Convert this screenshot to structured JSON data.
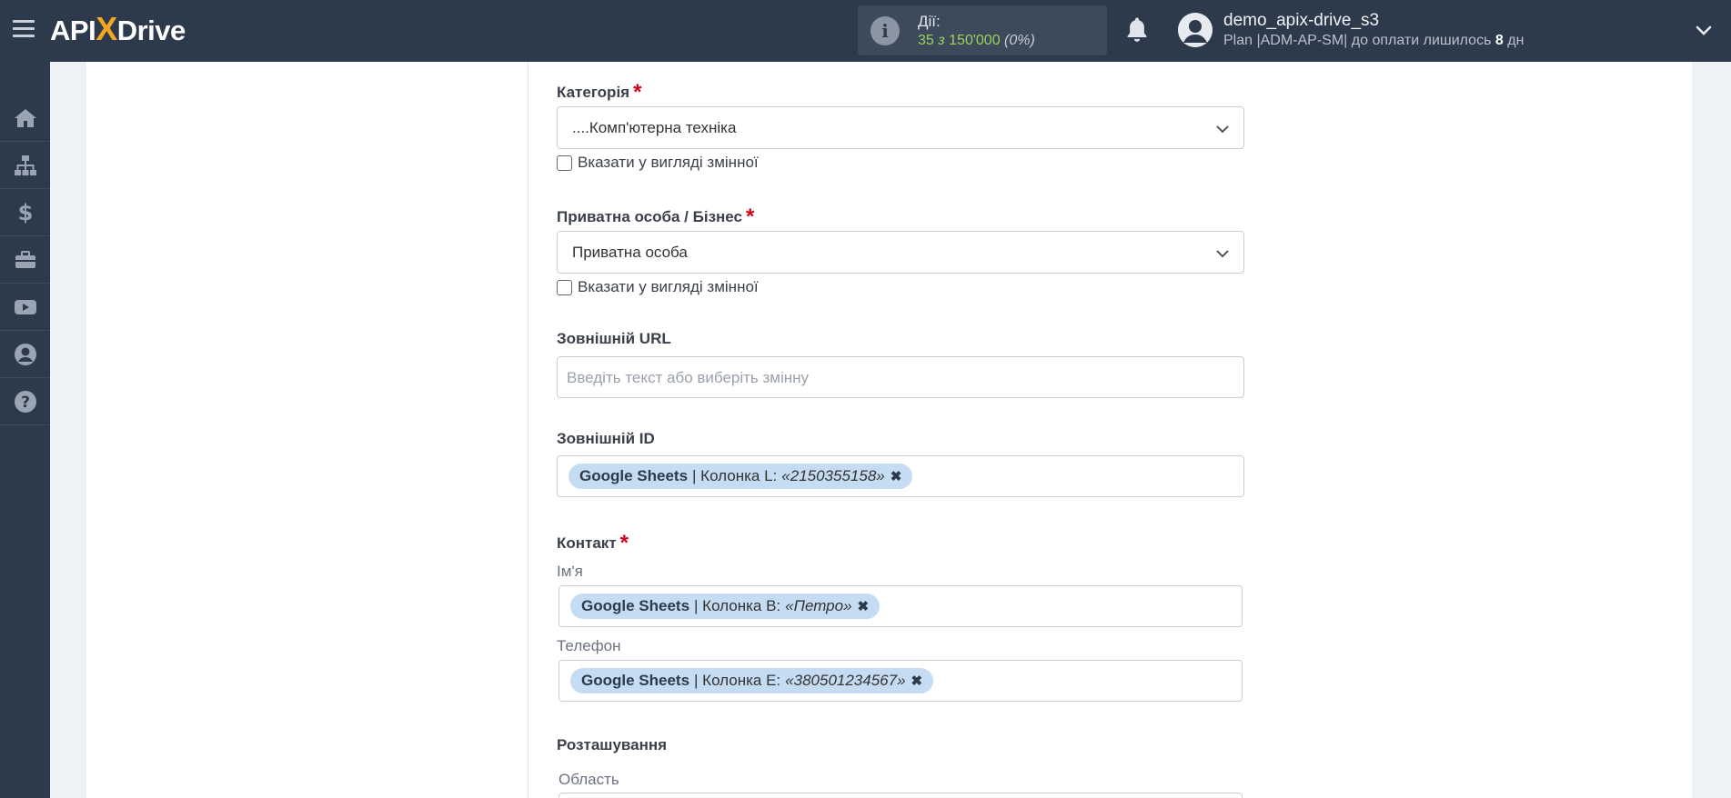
{
  "header": {
    "logo_api": "API",
    "logo_x": "X",
    "logo_drive": "Drive",
    "actions_label": "Дії:",
    "actions_used": "35",
    "actions_of": "з",
    "actions_total": "150'000",
    "actions_pct": "(0%)",
    "user_name": "demo_apix-drive_s3",
    "plan_prefix": "Plan |ADM-AP-SM| до оплати лишилось",
    "plan_days": "8",
    "plan_suffix": "дн"
  },
  "sidebar": {
    "items": [
      "home-icon",
      "sitemap-icon",
      "dollar-icon",
      "briefcase-icon",
      "youtube-icon",
      "user-circle-icon",
      "help-icon"
    ]
  },
  "form": {
    "category": {
      "label": "Категорія",
      "required_mark": "*",
      "value": "....Комп'ютерна техніка",
      "checkbox_label": "Вказати у вигляді змінної"
    },
    "person_business": {
      "label": "Приватна особа / Бізнес",
      "required_mark": "*",
      "value": "Приватна особа",
      "checkbox_label": "Вказати у вигляді змінної"
    },
    "external_url": {
      "label": "Зовнішній URL",
      "placeholder": "Введіть текст або виберіть змінну"
    },
    "external_id": {
      "label": "Зовнішній ID",
      "tag_source": "Google Sheets",
      "tag_column": "| Колонка L:",
      "tag_value": "«2150355158»"
    },
    "contact": {
      "label": "Контакт",
      "required_mark": "*",
      "name_label": "Ім'я",
      "name_tag_source": "Google Sheets",
      "name_tag_column": "| Колонка B:",
      "name_tag_value": "«Петро»",
      "phone_label": "Телефон",
      "phone_tag_source": "Google Sheets",
      "phone_tag_column": "| Колонка E:",
      "phone_tag_value": "«380501234567»"
    },
    "location": {
      "label": "Розташування",
      "region_label": "Область"
    }
  },
  "colors": {
    "header_bg": "#2d3a4b",
    "accent": "#f5a623",
    "tag_bg": "#c5dcf3",
    "required": "#d0021b",
    "actions_count": "#9fd05b"
  }
}
